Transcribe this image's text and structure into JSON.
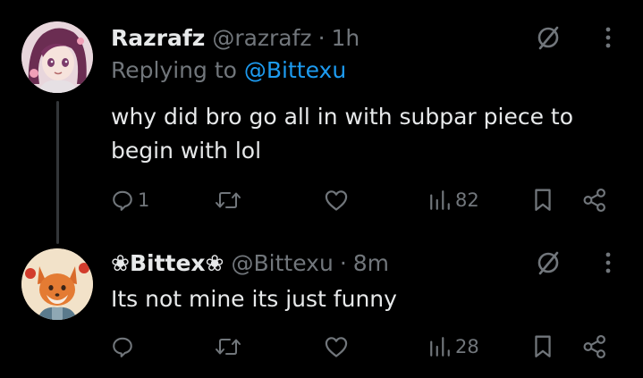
{
  "colors": {
    "background": "#000000",
    "primary_text": "#e7e9ea",
    "secondary_text": "#71767b",
    "link": "#1d9bf0",
    "thread_line": "#333639"
  },
  "tweets": [
    {
      "display_name": "Razrafz",
      "handle": "@razrafz",
      "separator": "·",
      "time": "1h",
      "replying_prefix": "Replying to",
      "replying_to": "@Bittexu",
      "text": "why did bro go all in with subpar piece to begin with lol",
      "avatar_icon": "anime-girl-avatar",
      "reply_count": "1",
      "repost_count": "",
      "like_count": "",
      "view_count": "82"
    },
    {
      "display_name": "❀Bittex❀",
      "handle": "@Bittexu",
      "separator": "·",
      "time": "8m",
      "text": "Its not mine its just funny",
      "avatar_icon": "fox-avatar",
      "reply_count": "",
      "repost_count": "",
      "like_count": "",
      "view_count": "28"
    }
  ]
}
